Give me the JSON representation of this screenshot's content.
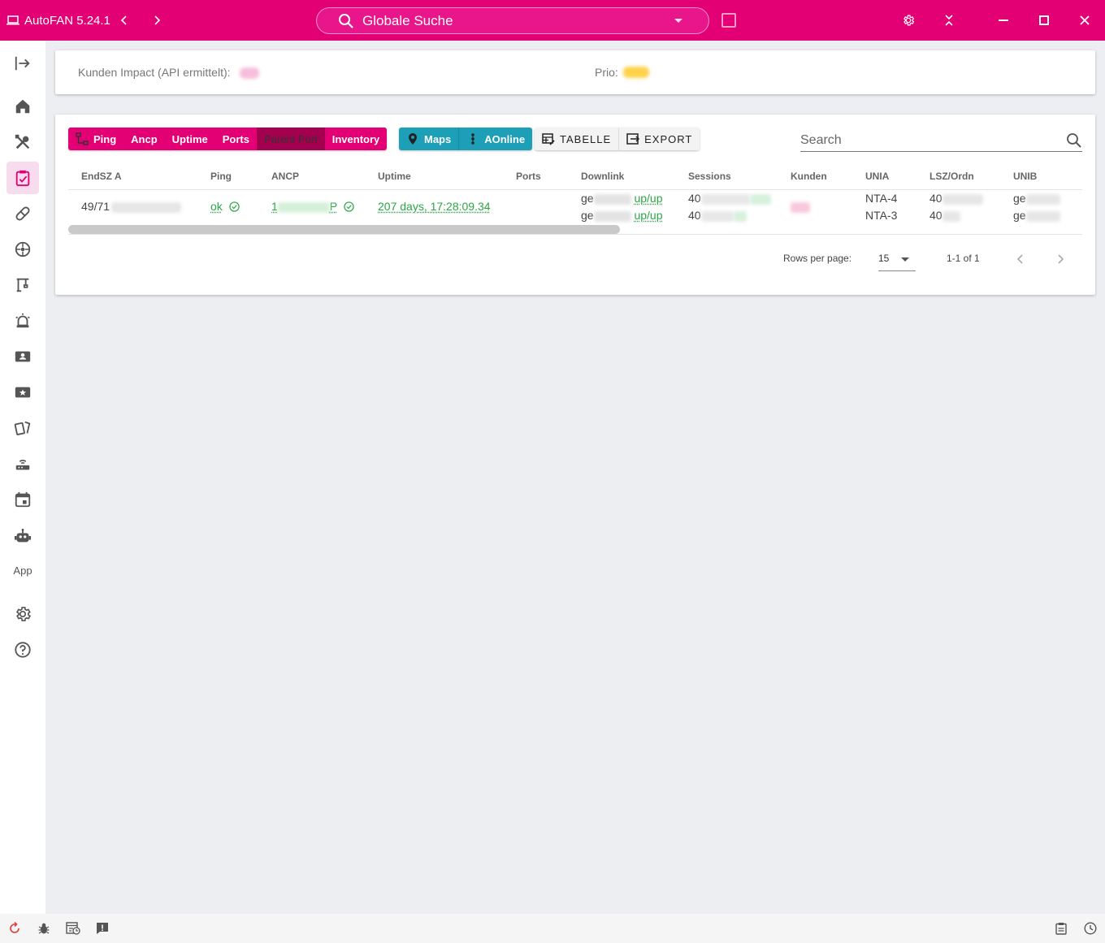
{
  "titlebar": {
    "app_title": "AutoFAN 5.24.1",
    "search_placeholder": "Globale Suche",
    "accent": "#e20074"
  },
  "sidebar": {
    "items": [
      {
        "icon": "expand-sidebar-icon"
      },
      {
        "icon": "home-icon"
      },
      {
        "icon": "tools-icon"
      },
      {
        "icon": "clipboard-check-icon",
        "active": true
      },
      {
        "icon": "pill-icon"
      },
      {
        "icon": "network-hub-icon"
      },
      {
        "icon": "crane-icon"
      },
      {
        "icon": "alarm-light-icon"
      },
      {
        "icon": "contact-card-icon"
      },
      {
        "icon": "ticket-star-icon"
      },
      {
        "icon": "cards-icon"
      },
      {
        "icon": "router-icon"
      },
      {
        "icon": "calendar-icon"
      },
      {
        "icon": "robot-icon"
      }
    ],
    "app_label": "App",
    "bottom_items": [
      {
        "icon": "settings-icon"
      },
      {
        "icon": "help-icon"
      }
    ]
  },
  "impact": {
    "kunden_impact_label": "Kunden Impact (API ermittelt):",
    "prio_label": "Prio:"
  },
  "toolbar": {
    "group1": [
      "Ping",
      "Ancp",
      "Uptime",
      "Ports",
      "Parent Port",
      "Inventory"
    ],
    "group2": [
      "Maps",
      "AOnline"
    ],
    "table_label": "TABELLE",
    "export_label": "EXPORT",
    "search_placeholder": "Search"
  },
  "table": {
    "columns": [
      "EndSZ A",
      "Ping",
      "ANCP",
      "Uptime",
      "Ports",
      "Downlink",
      "Sessions",
      "Kunden",
      "UNIA",
      "LSZ/Ordn",
      "UNIB"
    ],
    "row": {
      "endsz": "49/71",
      "ping": "ok",
      "ancp_prefix": "1",
      "ancp_suffix": "P",
      "uptime": "207 days, 17:28:09.34",
      "downlink": [
        {
          "prefix": "ge",
          "status": "up/up"
        },
        {
          "prefix": "ge",
          "status": "up/up"
        }
      ],
      "sessions": [
        "40",
        "40"
      ],
      "unia": [
        "NTA-4",
        "NTA-3"
      ],
      "lsz": [
        "40",
        "40"
      ],
      "unib": [
        "ge",
        "ge"
      ]
    }
  },
  "pagination": {
    "rows_per_page_label": "Rows per page:",
    "rows_per_page": "15",
    "range": "1-1 of 1"
  }
}
